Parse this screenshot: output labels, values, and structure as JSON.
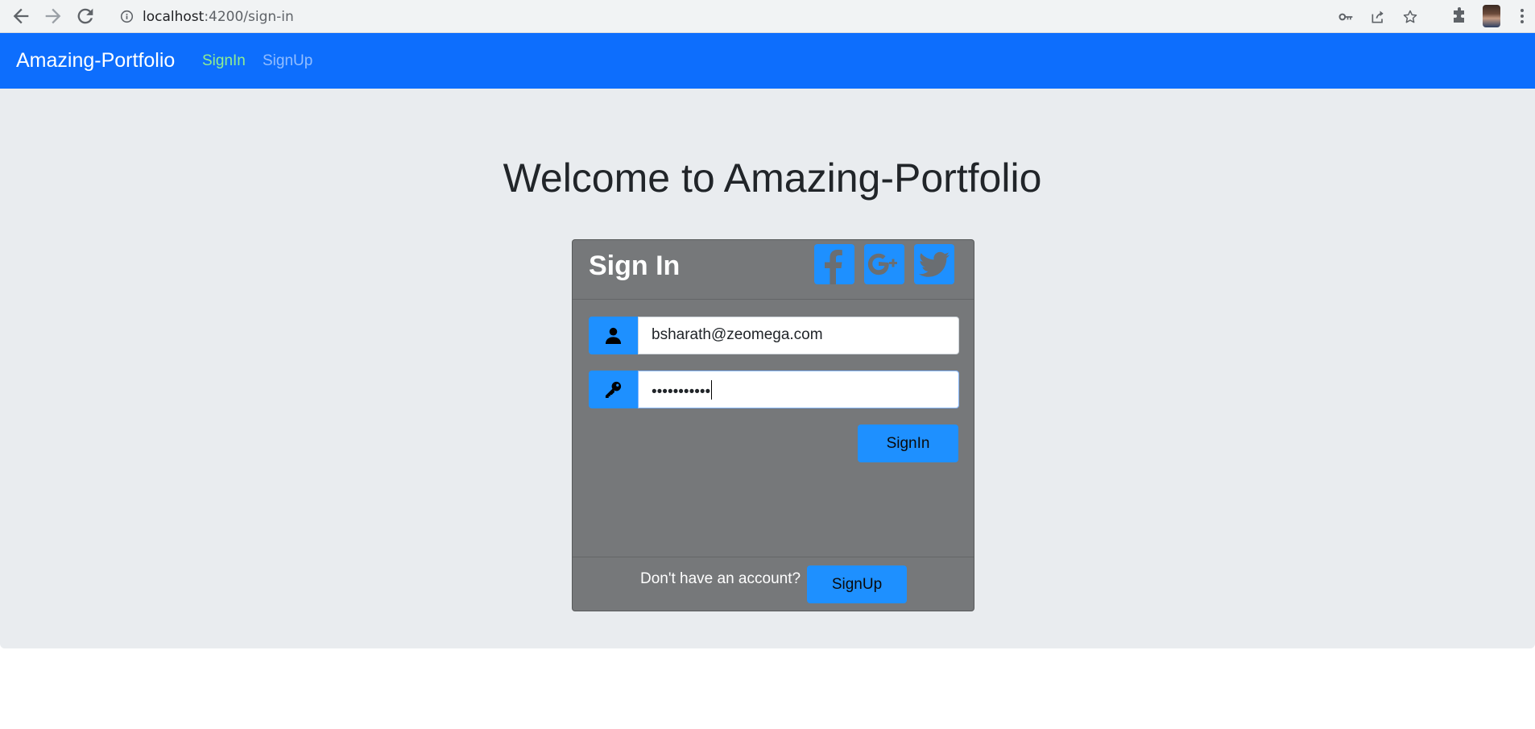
{
  "browser": {
    "url_host": "localhost",
    "url_path": ":4200/sign-in",
    "icons": [
      "back-icon",
      "forward-icon",
      "reload-icon",
      "info-icon",
      "key-icon",
      "share-icon",
      "star-icon",
      "extensions-icon",
      "profile-avatar",
      "menu-icon"
    ]
  },
  "navbar": {
    "brand": "Amazing-Portfolio",
    "links": [
      {
        "label": "SignIn",
        "active": true,
        "color": "#90ee90"
      },
      {
        "label": "SignUp",
        "active": false
      }
    ],
    "color": "#0d6efd"
  },
  "main": {
    "heading": "Welcome to Amazing-Portfolio"
  },
  "card": {
    "title": "Sign In",
    "social_icons": [
      "facebook-icon",
      "google-plus-icon",
      "twitter-icon"
    ],
    "email_value": "bsharath@zeomega.com",
    "password_value": "•••••••••••",
    "signin_label": "SignIn",
    "footer_text": "Don't have an account?",
    "signup_label": "SignUp",
    "accent": "#1e90ff"
  }
}
